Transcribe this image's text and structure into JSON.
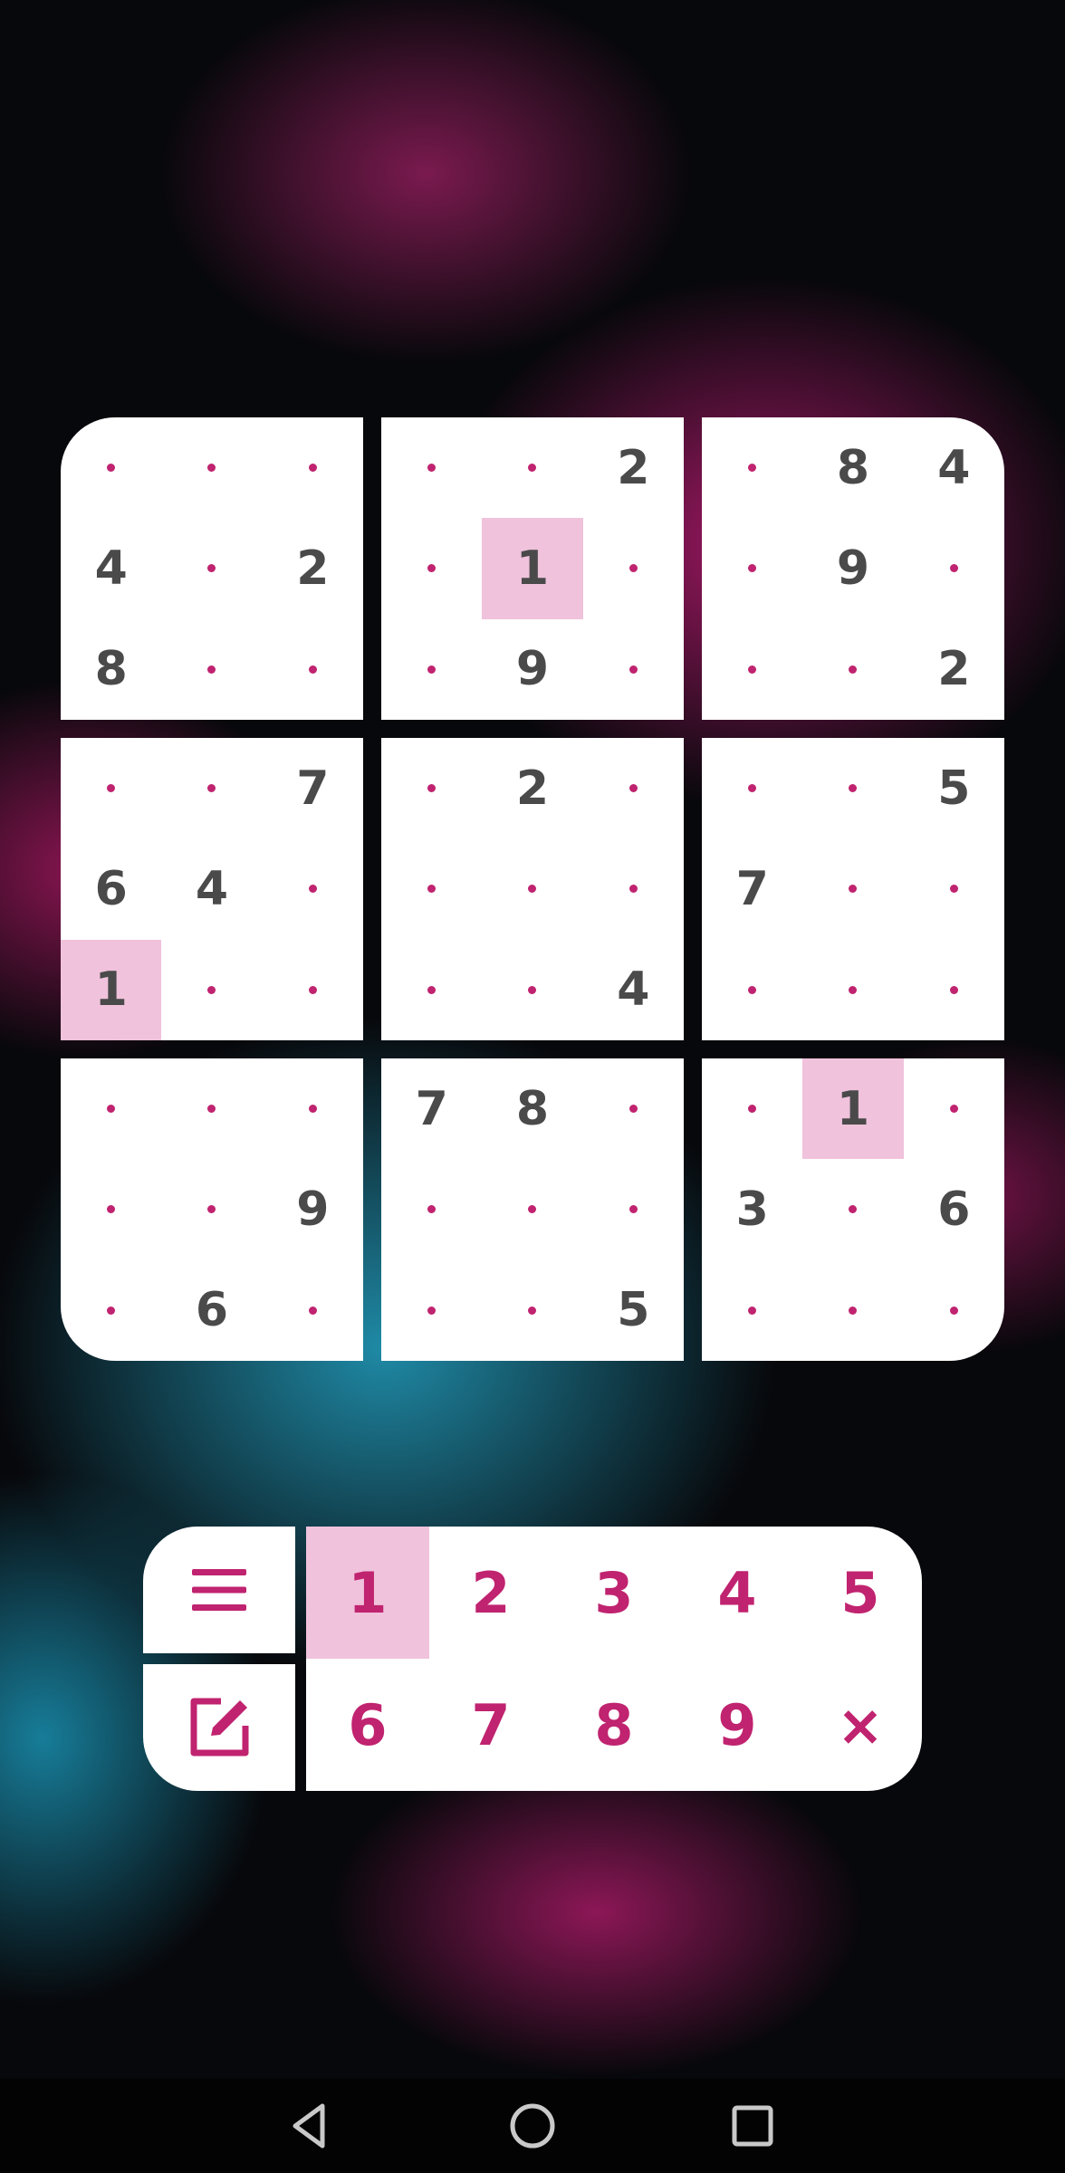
{
  "board": {
    "rows": [
      [
        "",
        "",
        "",
        "",
        "",
        "2",
        "",
        "8",
        "4"
      ],
      [
        "4",
        "",
        "2",
        "",
        "1",
        "",
        "",
        "9",
        ""
      ],
      [
        "8",
        "",
        "",
        "",
        "9",
        "",
        "",
        "",
        "2"
      ],
      [
        "",
        "",
        "7",
        "",
        "2",
        "",
        "",
        "",
        "5"
      ],
      [
        "6",
        "4",
        "",
        "",
        "",
        "",
        "7",
        "",
        ""
      ],
      [
        "1",
        "",
        "",
        "",
        "",
        "4",
        "",
        "",
        ""
      ],
      [
        "",
        "",
        "",
        "7",
        "8",
        "",
        "",
        "1",
        ""
      ],
      [
        "",
        "",
        "9",
        "",
        "",
        "",
        "3",
        "",
        "6"
      ],
      [
        "",
        "6",
        "",
        "",
        "",
        "5",
        "",
        "",
        ""
      ]
    ],
    "highlighted_cells": [
      [
        1,
        4
      ],
      [
        5,
        0
      ],
      [
        6,
        7
      ]
    ]
  },
  "number_pad": {
    "keys": [
      "1",
      "2",
      "3",
      "4",
      "5",
      "6",
      "7",
      "8",
      "9",
      "×"
    ],
    "selected": "1",
    "menu_icon": "menu-icon",
    "notes_icon": "edit-notes-icon"
  },
  "nav_bar": {
    "icons": [
      "back-icon",
      "home-icon",
      "recents-icon"
    ]
  },
  "colors": {
    "accent": "#c0236f",
    "highlight": "#f0c2dc",
    "given_digit": "#4a4a4a",
    "panel": "#ffffff"
  }
}
